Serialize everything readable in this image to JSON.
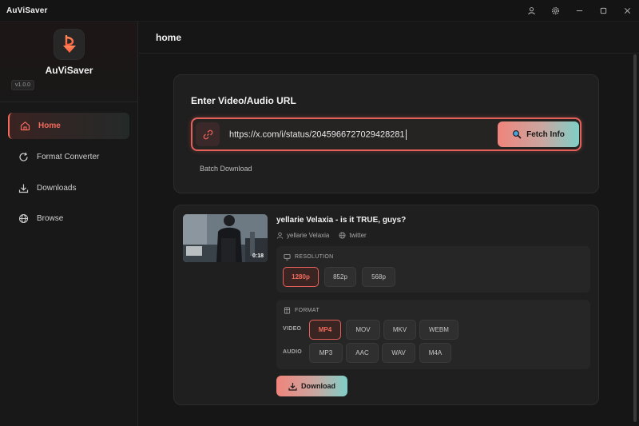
{
  "app": {
    "title": "AuViSaver",
    "name": "AuViSaver",
    "version": "v1.0.0"
  },
  "titlebar_icons": [
    "user-icon",
    "gear-icon",
    "minimize-icon",
    "maximize-icon",
    "close-icon"
  ],
  "sidebar": {
    "items": [
      {
        "label": "Home",
        "icon": "home-icon",
        "active": true
      },
      {
        "label": "Format Converter",
        "icon": "refresh-icon",
        "active": false
      },
      {
        "label": "Downloads",
        "icon": "download-icon",
        "active": false
      },
      {
        "label": "Browse",
        "icon": "globe-icon",
        "active": false
      }
    ]
  },
  "header": {
    "title": "home"
  },
  "url_card": {
    "title": "Enter Video/Audio URL",
    "url_value": "https://x.com/i/status/2045966727029428281",
    "fetch_label": "Fetch Info",
    "batch_label": "Batch Download"
  },
  "result": {
    "title": "yellarie Velaxia - is it TRUE, guys?",
    "author": "yellarie Velaxia",
    "platform": "twitter",
    "duration": "0:18",
    "resolution_label": "RESOLUTION",
    "resolutions": [
      {
        "label": "1280p",
        "selected": true
      },
      {
        "label": "852p",
        "selected": false
      },
      {
        "label": "568p",
        "selected": false
      }
    ],
    "format_label": "FORMAT",
    "video_label": "VIDEO",
    "audio_label": "AUDIO",
    "video_formats": [
      {
        "label": "MP4",
        "selected": true
      },
      {
        "label": "MOV",
        "selected": false
      },
      {
        "label": "MKV",
        "selected": false
      },
      {
        "label": "WEBM",
        "selected": false
      }
    ],
    "audio_formats": [
      {
        "label": "MP3",
        "selected": false
      },
      {
        "label": "AAC",
        "selected": false
      },
      {
        "label": "WAV",
        "selected": false
      },
      {
        "label": "M4A",
        "selected": false
      }
    ],
    "download_label": "Download"
  },
  "colors": {
    "accent": "#e6605a",
    "accent_text": "#f36a5c",
    "teal": "#7fcfc8",
    "background": "#161616"
  }
}
